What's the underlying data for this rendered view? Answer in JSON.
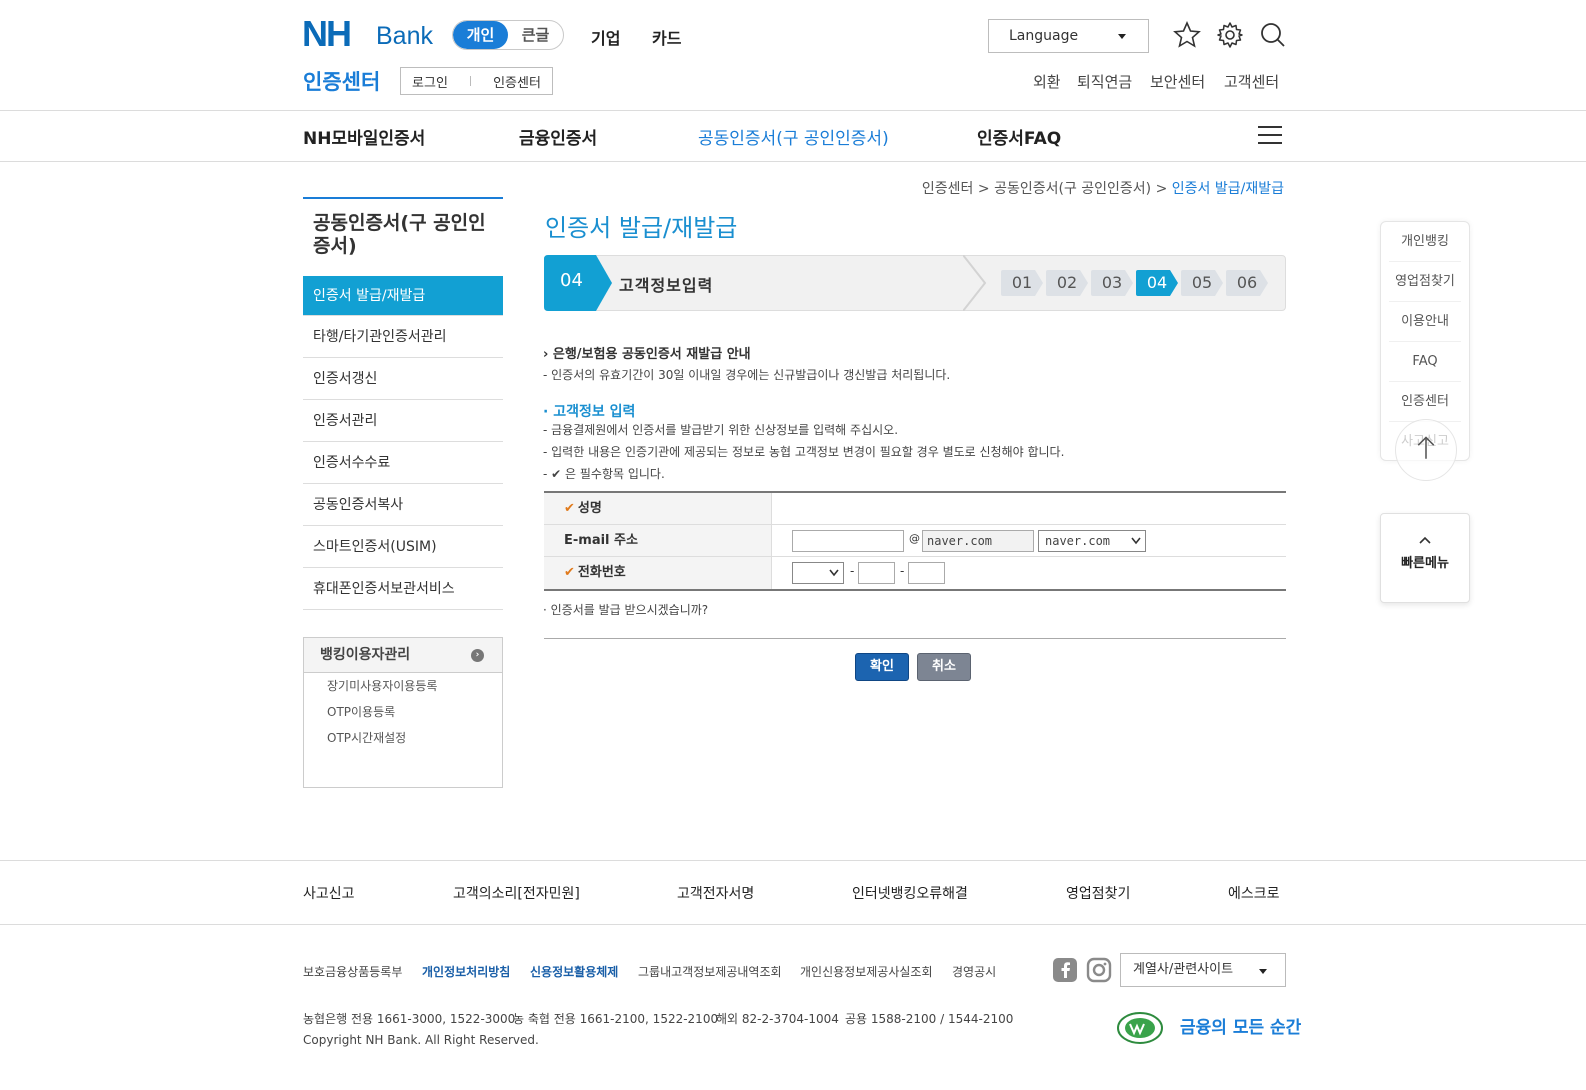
{
  "header": {
    "logo_nh": "NH",
    "logo_bank": "Bank",
    "mode_tabs": [
      "개인",
      "큰글"
    ],
    "top_nav": [
      "기업",
      "카드"
    ],
    "language_label": "Language",
    "center_title": "인증센터",
    "sub_links": [
      "로그인",
      "인증센터"
    ],
    "util_links": [
      "외환",
      "퇴직연금",
      "보안센터",
      "고객센터"
    ]
  },
  "gnb": [
    "NH모바일인증서",
    "금융인증서",
    "공동인증서(구 공인인증서)",
    "인증서FAQ"
  ],
  "breadcrumb": [
    "인증센터",
    "공동인증서(구 공인인증서)",
    "인증서 발급/재발급"
  ],
  "breadcrumb_sep": ">",
  "lnb": {
    "title": "공동인증서(구 공인인증서)",
    "items": [
      "인증서 발급/재발급",
      "타행/타기관인증서관리",
      "인증서갱신",
      "인증서관리",
      "인증서수수료",
      "공동인증서복사",
      "스마트인증서(USIM)",
      "휴대폰인증서보관서비스"
    ],
    "banking_title": "뱅킹이용자관리",
    "banking_links": [
      "장기미사용자이용등록",
      "OTP이용등록",
      "OTP시간재설정"
    ]
  },
  "main": {
    "title": "인증서 발급/재발급",
    "step_current": "04",
    "step_label": "고객정보입력",
    "steps": [
      "01",
      "02",
      "03",
      "04",
      "05",
      "06"
    ],
    "notice_title": "은행/보험용 공동인증서 재발급 안내",
    "notice_desc": "- 인증서의 유효기간이 30일 이내일 경우에는 신규발급이나 갱신발급 처리됩니다.",
    "section_title": "고객정보 입력",
    "section_desc": [
      "- 금융결제원에서 인증서를 발급받기 위한 신상정보를 입력해 주십시오.",
      "- 입력한 내용은 인증기관에 제공되는 정보로 농협 고객정보 변경이 필요할 경우 별도로 신청해야 합니다.",
      "- ✔ 은 필수항목 입니다."
    ],
    "form": {
      "name_label": "성명",
      "email_label": "E-mail 주소",
      "email_at": "@",
      "email_domain": "naver.com",
      "email_select": "naver.com",
      "phone_label": "전화번호",
      "phone_dash": "-"
    },
    "question": "· 인증서를 발급 받으시겠습니까?",
    "btn_ok": "확인",
    "btn_cancel": "취소"
  },
  "quick": {
    "items": [
      "개인뱅킹",
      "영업점찾기",
      "이용안내",
      "FAQ",
      "인증센터",
      "사고신고"
    ],
    "fast_menu": "빠른메뉴"
  },
  "footer": {
    "links": [
      "사고신고",
      "고객의소리[전자민원]",
      "고객전자서명",
      "인터넷뱅킹오류해결",
      "영업점찾기",
      "에스크로"
    ],
    "sub_links": [
      "보호금융상품등록부",
      "개인정보처리방침",
      "신용정보활용체제",
      "그룹내고객정보제공내역조회",
      "개인신용정보제공사실조회",
      "경영공시"
    ],
    "phones": [
      "농협은행 전용 1661-3000, 1522-3000",
      "농 축협 전용 1661-2100, 1522-2100",
      "해외 82-2-3704-1004",
      "공용 1588-2100 / 1544-2100"
    ],
    "copyright": "Copyright NH Bank. All Right Reserved.",
    "family_label": "계열사/관련사이트",
    "slogan": "금융의 모든 순간"
  },
  "colors": {
    "brand": "#0b6bb8",
    "accent": "#1a7dd7",
    "step": "#12a0d3",
    "check": "#e07a1c"
  }
}
